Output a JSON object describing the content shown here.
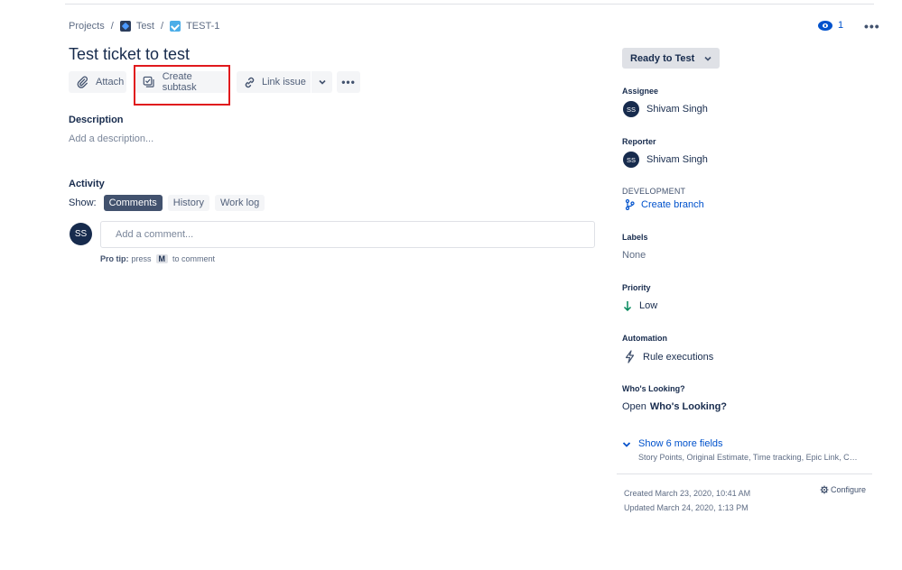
{
  "breadcrumb": {
    "projects": "Projects",
    "sep1": "/",
    "project": "Test",
    "sep2": "/",
    "issue_key": "TEST-1"
  },
  "header": {
    "watch_count": "1",
    "more": "•••"
  },
  "issue": {
    "title": "Test ticket to test"
  },
  "toolbar": {
    "attach": "Attach",
    "create_subtask": "Create subtask",
    "link_issue": "Link issue",
    "more": "•••"
  },
  "description": {
    "heading": "Description",
    "placeholder": "Add a description..."
  },
  "activity": {
    "heading": "Activity",
    "show_label": "Show:",
    "tabs": [
      "Comments",
      "History",
      "Work log"
    ],
    "active_tab": "Comments",
    "avatar_initials": "SS",
    "comment_placeholder": "Add a comment...",
    "protip_lead": "Pro tip:",
    "protip_press": "press",
    "protip_key": "M",
    "protip_tail": "to comment"
  },
  "sidebar": {
    "status": "Ready to Test",
    "assignee": {
      "label": "Assignee",
      "initials": "SS",
      "name": "Shivam Singh"
    },
    "reporter": {
      "label": "Reporter",
      "initials": "SS",
      "name": "Shivam Singh"
    },
    "development": {
      "label": "DEVELOPMENT",
      "action": "Create branch"
    },
    "labels": {
      "label": "Labels",
      "value": "None"
    },
    "priority": {
      "label": "Priority",
      "value": "Low"
    },
    "automation": {
      "label": "Automation",
      "value": "Rule executions"
    },
    "whos_looking": {
      "label": "Who's Looking?",
      "prefix": "Open",
      "value": "Who's Looking?"
    },
    "show_more": {
      "label": "Show 6 more fields",
      "fields": "Story Points, Original Estimate, Time tracking, Epic Link, Co..."
    },
    "created": "Created March 23, 2020, 10:41 AM",
    "updated": "Updated March 24, 2020, 1:13 PM",
    "configure": "Configure"
  },
  "colors": {
    "highlight_border": "#e0191d",
    "link": "#0052cc",
    "avatar_bg": "#172b4d",
    "active_tab_bg": "#42526e",
    "priority_low": "#00875a"
  }
}
